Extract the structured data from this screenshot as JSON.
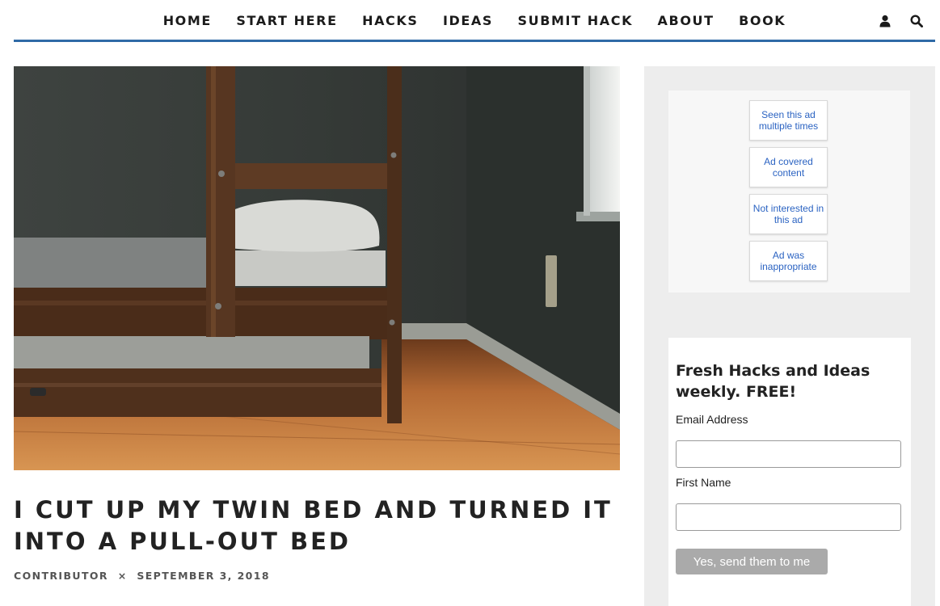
{
  "nav": {
    "items": [
      {
        "label": "HOME"
      },
      {
        "label": "START HERE"
      },
      {
        "label": "HACKS"
      },
      {
        "label": "IDEAS"
      },
      {
        "label": "SUBMIT HACK"
      },
      {
        "label": "ABOUT"
      },
      {
        "label": "BOOK"
      }
    ],
    "icons": [
      "user-icon",
      "search-icon"
    ],
    "accent_color": "#2f6aa6"
  },
  "article": {
    "title": "I CUT UP MY TWIN BED AND TURNED IT INTO A PULL-OUT BED",
    "author": "CONTRIBUTOR",
    "separator": "×",
    "date": "SEPTEMBER 3, 2018"
  },
  "ad_feedback": {
    "options": [
      "Seen this ad multiple times",
      "Ad covered content",
      "Not interested in this ad",
      "Ad was inappropriate"
    ]
  },
  "newsletter": {
    "heading": "Fresh Hacks and Ideas weekly. FREE!",
    "email_label": "Email Address",
    "email_value": "",
    "first_name_label": "First Name",
    "first_name_value": "",
    "submit_label": "Yes, send them to me"
  }
}
